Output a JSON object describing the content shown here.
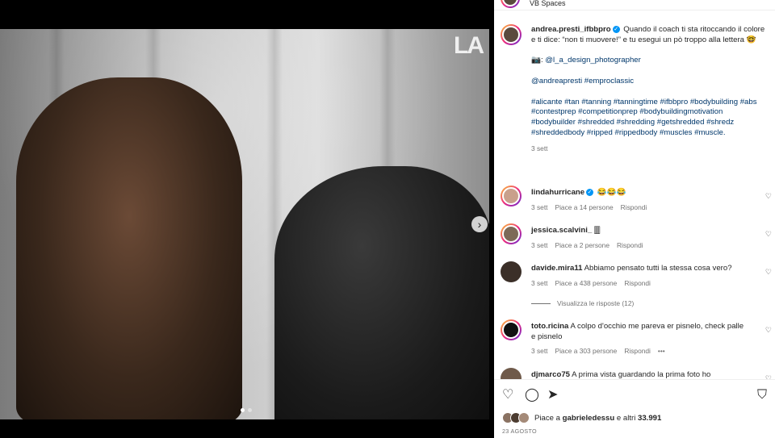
{
  "header": {
    "subtitle": "VB Spaces"
  },
  "media": {
    "watermark": "LA",
    "next_icon": "›",
    "current_slide": 1,
    "slide_count": 2
  },
  "caption": {
    "username": "andrea.presti_ifbbpro",
    "verified": true,
    "text": "Quando il coach ti sta ritoccando il colore e ti dice: “non ti muovere!” e tu esegui un pò troppo alla lettera 🤓",
    "photo_credit_prefix": "📷: ",
    "photo_credit": "@l_a_design_photographer",
    "mentions": "@andreapresti #emproclassic",
    "hashtags": "#alicante #tan #tanning #tanningtime #ifbbpro #bodybuilding #abs #contestprep #competitionprep #bodybuildingmotivation #bodybuilder #shredded #shredding #getshredded #shredz #shreddedbody #ripped #rippedbody #muscles #muscle.",
    "time": "3 sett"
  },
  "comments": [
    {
      "username": "lindahurricane",
      "verified": true,
      "text": "😂😂😂",
      "time": "3 sett",
      "likes": "Piace a 14 persone",
      "reply": "Rispondi",
      "avatar_color": "#c9a08c"
    },
    {
      "username": "jessica.scalvini_",
      "verified": false,
      "text": "🀫",
      "time": "3 sett",
      "likes": "Piace a 2 persone",
      "reply": "Rispondi",
      "avatar_color": "#7d6a58"
    },
    {
      "username": "davide.mira11",
      "verified": false,
      "text": "Abbiamo pensato tutti la stessa cosa vero?",
      "time": "3 sett",
      "likes": "Piace a 438 persone",
      "reply": "Rispondi",
      "avatar_color": "#3b2f28"
    },
    {
      "username": "toto.ricina",
      "verified": false,
      "text": "A colpo d'occhio me pareva er pisnelo, check palle e pisnelo",
      "time": "3 sett",
      "likes": "Piace a 303 persone",
      "reply": "Rispondi",
      "more": "•••",
      "avatar_color": "#111111"
    },
    {
      "username": "djmarco75",
      "verified": false,
      "text": "A prima vista guardando la prima foto ho",
      "avatar_color": "#6f5a4a"
    }
  ],
  "view_replies": "Visualizza le risposte (12)",
  "actions": {
    "like_icon": "♡",
    "comment_icon": "◯",
    "share_icon": "➤",
    "save_icon": "⛉"
  },
  "likes": {
    "prefix": "Piace a ",
    "user": "gabrieledessu",
    "suffix": " e altri ",
    "count": "33.991"
  },
  "date": "23 AGOSTO",
  "colors": {
    "link": "#00376b",
    "verified": "#0095f6",
    "meta": "#737373"
  }
}
